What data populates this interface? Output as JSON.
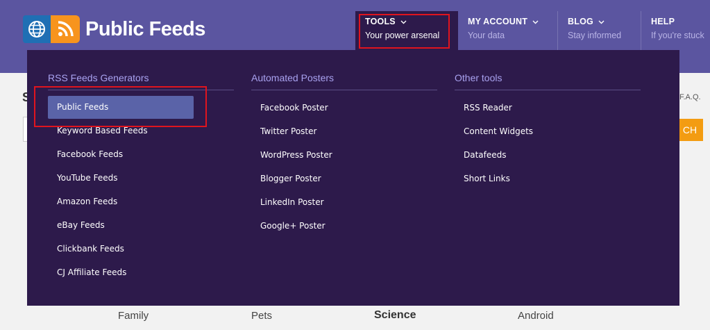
{
  "logo": {
    "text": "Public Feeds"
  },
  "nav": [
    {
      "title": "TOOLS",
      "subtitle": "Your power arsenal",
      "has_chevron": true
    },
    {
      "title": "MY ACCOUNT",
      "subtitle": "Your data",
      "has_chevron": true
    },
    {
      "title": "BLOG",
      "subtitle": "Stay informed",
      "has_chevron": true
    },
    {
      "title": "HELP",
      "subtitle": "If you're stuck",
      "has_chevron": false
    }
  ],
  "menu": {
    "columns": [
      {
        "title": "RSS Feeds Generators",
        "items": [
          "Public Feeds",
          "Keyword Based Feeds",
          "Facebook Feeds",
          "YouTube Feeds",
          "Amazon Feeds",
          "eBay Feeds",
          "Clickbank Feeds",
          "CJ Affiliate Feeds"
        ]
      },
      {
        "title": "Automated Posters",
        "items": [
          "Facebook Poster",
          "Twitter Poster",
          "WordPress Poster",
          "Blogger Poster",
          "LinkedIn Poster",
          "Google+ Poster"
        ]
      },
      {
        "title": "Other tools",
        "items": [
          "RSS Reader",
          "Content Widgets",
          "Datafeeds",
          "Short Links"
        ]
      }
    ],
    "active_item": "Public Feeds"
  },
  "background": {
    "heading_fragment": "S",
    "faq_fragment": "F.A.Q.",
    "search_button_fragment": "CH",
    "categories_row1": [
      "Family",
      "Pets",
      "Science",
      "Android"
    ]
  },
  "colors": {
    "header_bg": "#5b55a0",
    "menu_bg": "#2d1a4b",
    "active_item_bg": "#5a63a8",
    "column_title": "#a9a2f0",
    "highlight": "#e0141e",
    "accent_orange": "#f39c12"
  }
}
